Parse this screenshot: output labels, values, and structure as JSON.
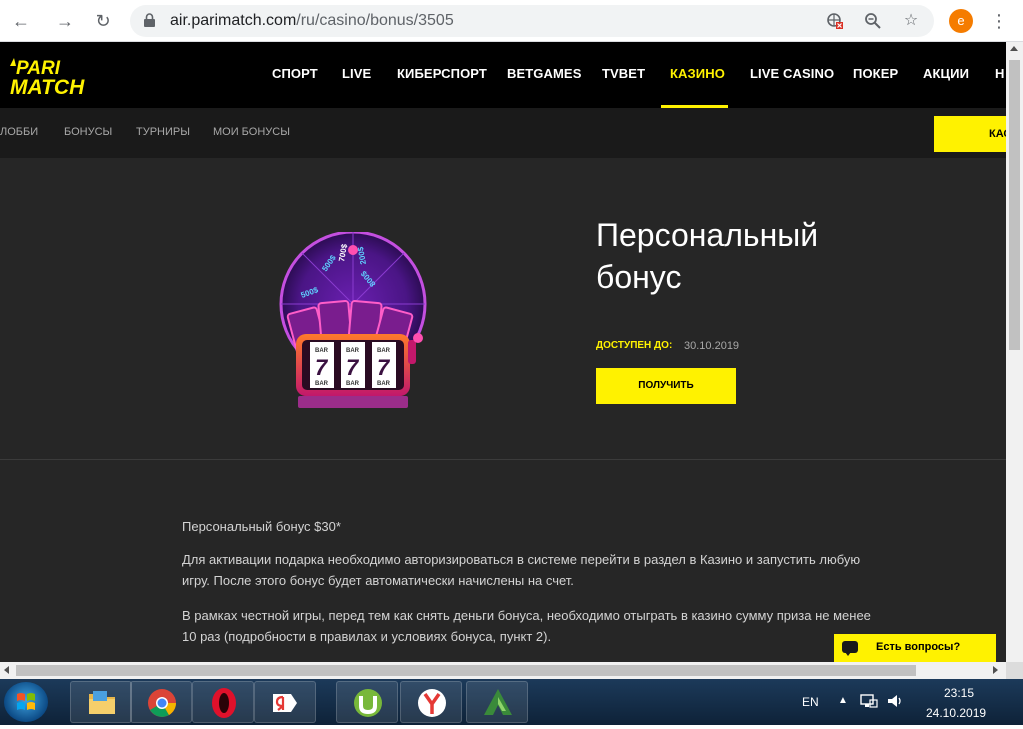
{
  "browser": {
    "url_host": "air.parimatch.com",
    "url_path": "/ru/casino/bonus/3505",
    "profile_initial": "e"
  },
  "site": {
    "logo_line1": "PARI",
    "logo_line2": "MATCH",
    "nav": [
      {
        "label": "СПОРТ",
        "active": false
      },
      {
        "label": "LIVE",
        "active": false
      },
      {
        "label": "КИБЕРСПОРТ",
        "active": false
      },
      {
        "label": "BETGAMES",
        "active": false
      },
      {
        "label": "TVBET",
        "active": false
      },
      {
        "label": "КАЗИНО",
        "active": true
      },
      {
        "label": "LIVE CASINO",
        "active": false
      },
      {
        "label": "ПОКЕР",
        "active": false
      },
      {
        "label": "АКЦИИ",
        "active": false
      },
      {
        "label": "Н",
        "active": false
      }
    ],
    "subnav": [
      "ЛОББИ",
      "БОНУСЫ",
      "ТУРНИРЫ",
      "МОИ БОНУСЫ"
    ],
    "cashier_label": "КАС",
    "accent_color": "#fff200"
  },
  "bonus": {
    "title": "Персональный бонус",
    "available_label": "ДОСТУПЕН ДО:",
    "available_date": "30.10.2019",
    "get_button": "ПОЛУЧИТЬ",
    "art_labels": [
      "500$",
      "700$",
      "200$",
      "800$",
      "500$",
      "BAR",
      "BAR",
      "BAR",
      "BAR",
      "BAR",
      "BAR",
      "7",
      "7",
      "7"
    ]
  },
  "content": {
    "p1": "Персональный бонус $30*",
    "p2": "Для активации подарка необходимо авторизироваться в системе перейти в раздел в Казино и запустить любую игру. После этого бонус будет автоматически начислены на счет.",
    "p3": "В рамках честной игры, перед тем как снять деньги бонуса, необходимо отыграть в казино сумму приза не менее 10 раз (подробности в правилах и условиях бонуса, пункт 2)."
  },
  "chat": {
    "label": "Есть вопросы?"
  },
  "taskbar": {
    "lang": "EN",
    "time": "23:15",
    "date": "24.10.2019"
  }
}
